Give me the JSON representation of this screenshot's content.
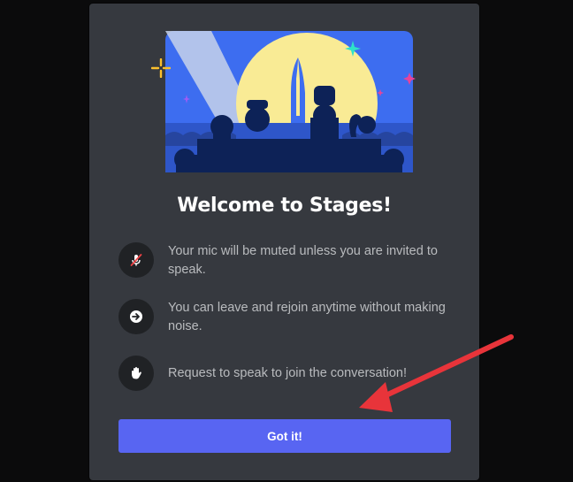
{
  "dialog": {
    "title": "Welcome to Stages!",
    "features": [
      {
        "icon": "muted-mic-icon",
        "text": "Your mic will be muted unless you are invited to speak."
      },
      {
        "icon": "leave-arrow-icon",
        "text": "You can leave and rejoin anytime without making noise."
      },
      {
        "icon": "raised-hand-icon",
        "text": "Request to speak to join the conversation!"
      }
    ],
    "confirm_label": "Got it!"
  },
  "colors": {
    "page_background": "#0b0b0c",
    "modal_background": "#36393f",
    "icon_circle": "#202225",
    "button": "#5865f2",
    "annotation_arrow": "#e8343a"
  },
  "annotation": {
    "icon": "red-arrow-pointing-to-button"
  }
}
